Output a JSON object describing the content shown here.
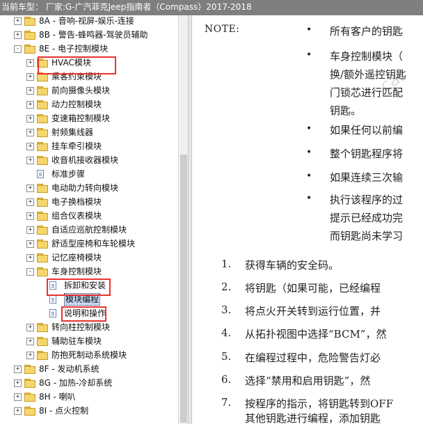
{
  "title": "当前车型： 厂家:G-广汽菲克Jeep指南者（Compass）2017-2018",
  "tree": [
    {
      "label": "8A - 音响-视屏-娱乐-连接",
      "type": "folder",
      "exp": "+",
      "level": 0
    },
    {
      "label": "8B - 警告-蜂鸣器-驾驶员辅助",
      "type": "folder",
      "exp": "+",
      "level": 0
    },
    {
      "label": "8E - 电子控制模块",
      "type": "folder",
      "exp": "-",
      "level": 0
    },
    {
      "label": "HVAC模块",
      "type": "folder",
      "exp": "+",
      "level": 1
    },
    {
      "label": "乘客约束模块",
      "type": "folder",
      "exp": "+",
      "level": 1
    },
    {
      "label": "前向摄像头模块",
      "type": "folder",
      "exp": "+",
      "level": 1
    },
    {
      "label": "动力控制模块",
      "type": "folder",
      "exp": "+",
      "level": 1
    },
    {
      "label": "变速箱控制模块",
      "type": "folder",
      "exp": "+",
      "level": 1
    },
    {
      "label": "射频集线器",
      "type": "folder",
      "exp": "+",
      "level": 1
    },
    {
      "label": "挂车牵引模块",
      "type": "folder",
      "exp": "+",
      "level": 1
    },
    {
      "label": "收音机接收器模块",
      "type": "folder",
      "exp": "+",
      "level": 1
    },
    {
      "label": "标准步骤",
      "type": "doc",
      "exp": "",
      "level": 1
    },
    {
      "label": "电动助力转向模块",
      "type": "folder",
      "exp": "+",
      "level": 1
    },
    {
      "label": "电子换档模块",
      "type": "folder",
      "exp": "+",
      "level": 1
    },
    {
      "label": "组合仪表模块",
      "type": "folder",
      "exp": "+",
      "level": 1
    },
    {
      "label": "自适应巡航控制模块",
      "type": "folder",
      "exp": "+",
      "level": 1
    },
    {
      "label": "舒适型座椅和车轮模块",
      "type": "folder",
      "exp": "+",
      "level": 1
    },
    {
      "label": "记忆座椅模块",
      "type": "folder",
      "exp": "+",
      "level": 1
    },
    {
      "label": "车身控制模块",
      "type": "folder",
      "exp": "-",
      "level": 1
    },
    {
      "label": "拆卸和安装",
      "type": "doc",
      "exp": "",
      "level": 2
    },
    {
      "label": "模块编程",
      "type": "doc",
      "exp": "",
      "level": 2,
      "selected": true
    },
    {
      "label": "说明和操作",
      "type": "doc",
      "exp": "",
      "level": 2
    },
    {
      "label": "转向柱控制模块",
      "type": "folder",
      "exp": "+",
      "level": 1
    },
    {
      "label": "辅助驻车模块",
      "type": "folder",
      "exp": "+",
      "level": 1
    },
    {
      "label": "防抱死制动系统模块",
      "type": "folder",
      "exp": "+",
      "level": 1
    },
    {
      "label": "8F - 发动机系统",
      "type": "folder",
      "exp": "+",
      "level": 0
    },
    {
      "label": "8G - 加热-冷却系统",
      "type": "folder",
      "exp": "+",
      "level": 0
    },
    {
      "label": "8H - 喇叭",
      "type": "folder",
      "exp": "+",
      "level": 0
    },
    {
      "label": "8I - 点火控制",
      "type": "folder",
      "exp": "+",
      "level": 0
    }
  ],
  "content": {
    "note_label": "NOTE:",
    "bullets": [
      [
        "所有客户的钥匙"
      ],
      [
        "车身控制模块（",
        "换/额外遥控钥匙",
        "门锁芯进行匹配",
        "钥匙。"
      ],
      [
        "如果任何以前编"
      ],
      [
        "整个钥匙程序将"
      ],
      [
        "如果连续三次输"
      ],
      [
        "执行该程序的过",
        "提示已经成功完",
        "而钥匙尚未学习"
      ]
    ],
    "steps": [
      {
        "num": "1.",
        "text": "获得车辆的安全码。"
      },
      {
        "num": "2.",
        "text": "将钥匙（如果可能，已经编程"
      },
      {
        "num": "3.",
        "text": "将点火开关转到运行位置，并"
      },
      {
        "num": "4.",
        "text": "从拓扑视图中选择“BCM”，然"
      },
      {
        "num": "5.",
        "text": "在编程过程中，危险警告灯必"
      },
      {
        "num": "6.",
        "text": "选择“禁用和启用钥匙”，然"
      },
      {
        "num": "7.",
        "text": "按程序的指示，将钥匙转到OFF"
      },
      {
        "num": "",
        "text": "其他钥匙进行编程，添加钥匙"
      }
    ],
    "watermark": "car"
  },
  "colors": {
    "titlebar": "#7f7f7f",
    "highlight": "#e8322e",
    "selection": "#c7dcf5"
  }
}
